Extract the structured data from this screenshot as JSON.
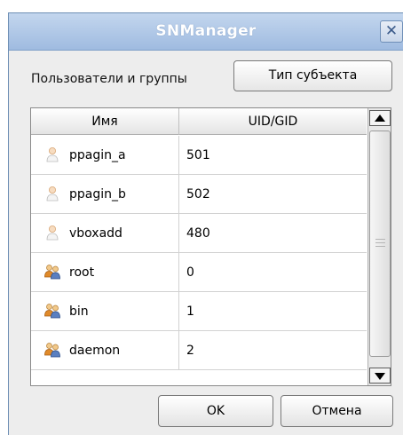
{
  "window": {
    "title": "SNManager",
    "close_glyph": "✕"
  },
  "toolbar": {
    "users_groups_label": "Пользователи и группы",
    "subject_type_button": "Тип субъекта"
  },
  "table": {
    "columns": [
      "Имя",
      "UID/GID"
    ],
    "rows": [
      {
        "icon": "user-icon",
        "name": "ppagin_a",
        "id": "501"
      },
      {
        "icon": "user-icon",
        "name": "ppagin_b",
        "id": "502"
      },
      {
        "icon": "user-icon",
        "name": "vboxadd",
        "id": "480"
      },
      {
        "icon": "group-icon",
        "name": "root",
        "id": "0"
      },
      {
        "icon": "group-icon",
        "name": "bin",
        "id": "1"
      },
      {
        "icon": "group-icon",
        "name": "daemon",
        "id": "2"
      }
    ]
  },
  "buttons": {
    "ok": "OK",
    "cancel": "Отмена"
  },
  "colors": {
    "titlebar": "#a9c2e4",
    "title_text": "#ffffff",
    "window_bg": "#ededed"
  }
}
